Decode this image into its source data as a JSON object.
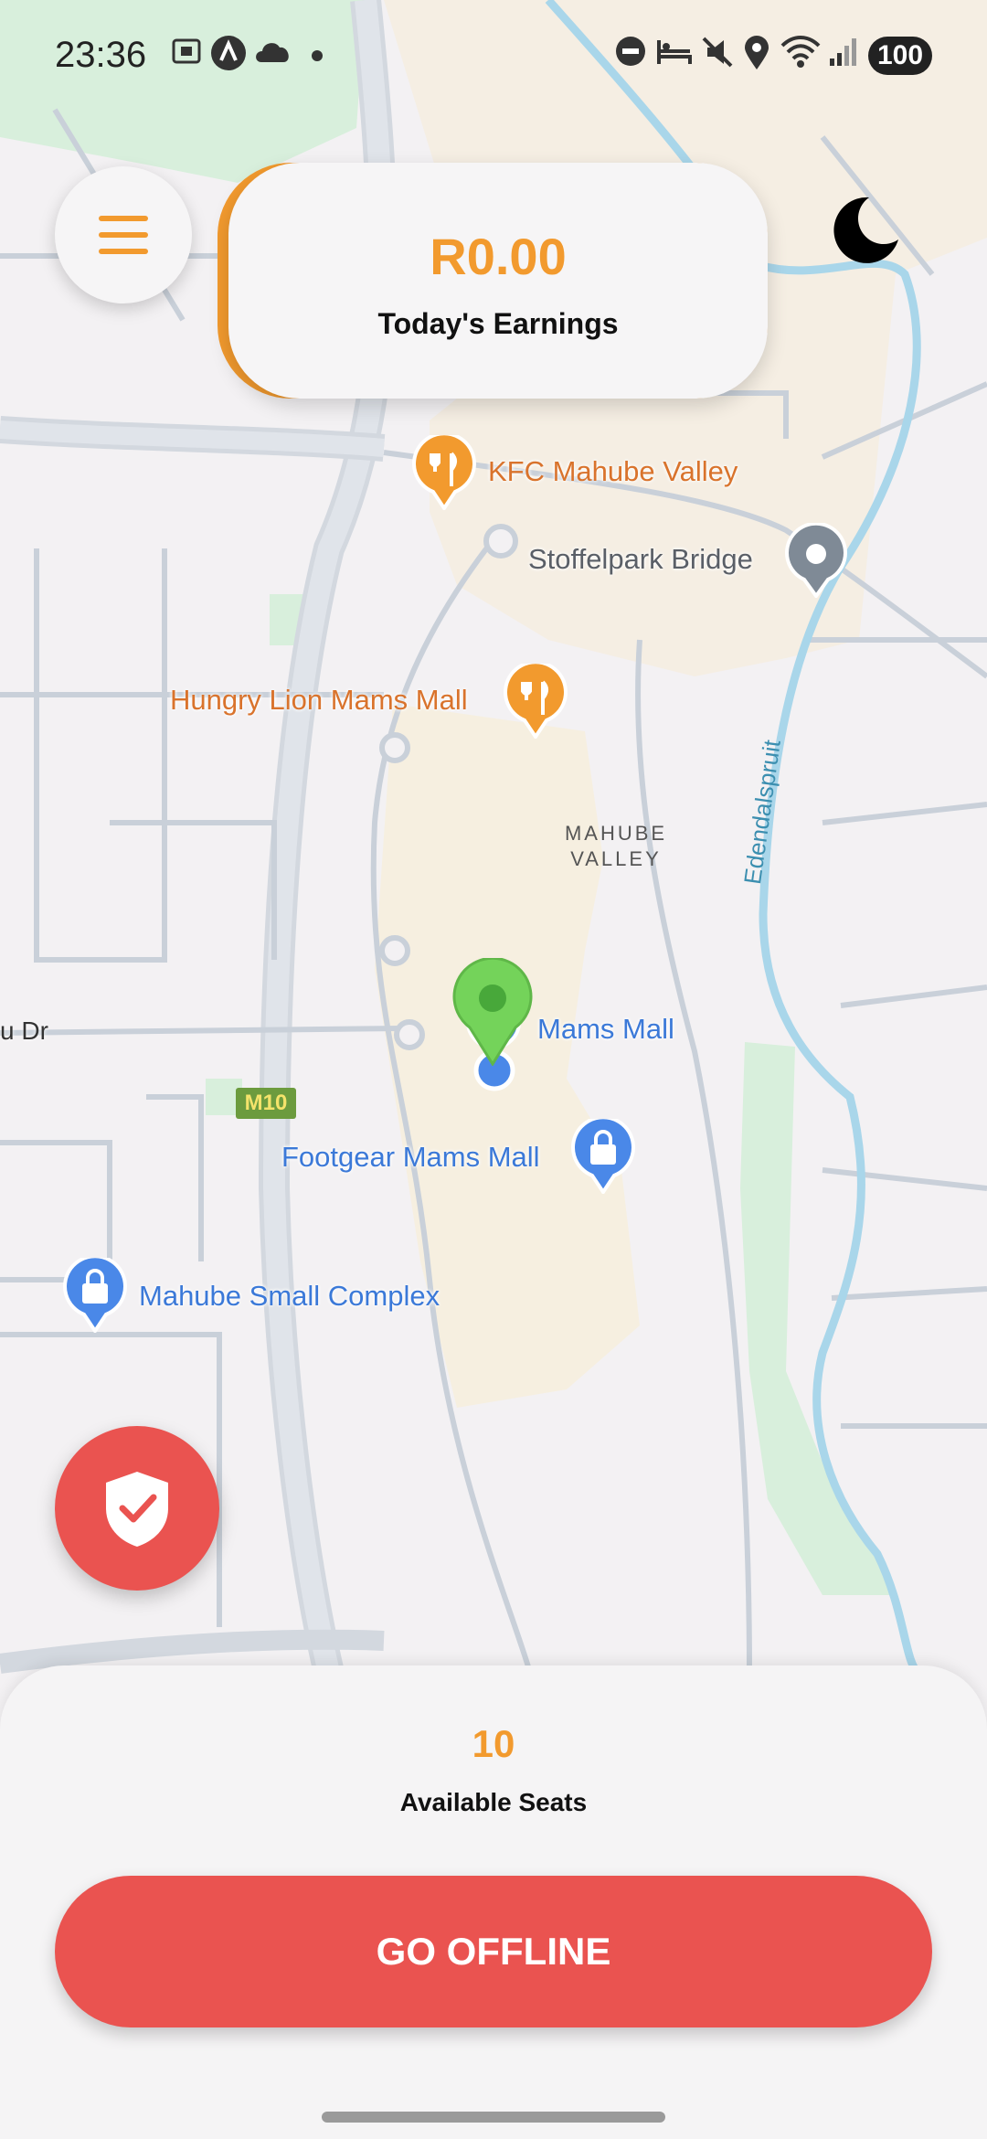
{
  "status_bar": {
    "time": "23:36",
    "battery": "100",
    "icons": [
      "screenshot-icon",
      "navigation-icon",
      "cloud-icon",
      "dot-icon",
      "dnd-icon",
      "bed-icon",
      "mute-icon",
      "location-icon",
      "wifi-icon",
      "signal-icon"
    ]
  },
  "earnings": {
    "amount": "R0.00",
    "label": "Today's Earnings"
  },
  "map": {
    "places": {
      "kfc": "KFC Mahube Valley",
      "stoffelpark": "Stoffelpark Bridge",
      "hungry_lion": "Hungry Lion Mams Mall",
      "area_line1": "MAHUBE",
      "area_line2": "VALLEY",
      "mams_mall": "Mams Mall",
      "road_dr": "u Dr",
      "m10": "M10",
      "footgear": "Footgear Mams Mall",
      "mahube_small": "Mahube Small Complex",
      "river": "Edendalspruit"
    }
  },
  "bottom_panel": {
    "seats_value": "10",
    "seats_label": "Available Seats",
    "offline_button": "GO OFFLINE"
  },
  "colors": {
    "accent": "#f29a2e",
    "danger": "#ea5350",
    "pin_green": "#74d35a",
    "user_blue": "#4a88e8"
  }
}
